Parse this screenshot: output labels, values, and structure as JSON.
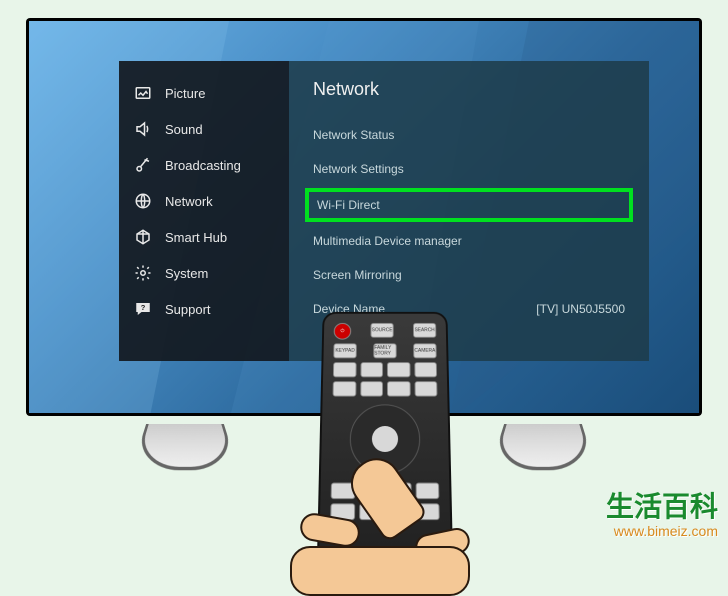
{
  "sidebar": {
    "items": [
      {
        "label": "Picture",
        "icon": "picture-icon"
      },
      {
        "label": "Sound",
        "icon": "sound-icon"
      },
      {
        "label": "Broadcasting",
        "icon": "broadcasting-icon"
      },
      {
        "label": "Network",
        "icon": "network-icon"
      },
      {
        "label": "Smart Hub",
        "icon": "smarthub-icon"
      },
      {
        "label": "System",
        "icon": "system-icon"
      },
      {
        "label": "Support",
        "icon": "support-icon"
      }
    ]
  },
  "content": {
    "title": "Network",
    "items": [
      {
        "label": "Network Status",
        "value": ""
      },
      {
        "label": "Network Settings",
        "value": ""
      },
      {
        "label": "Wi-Fi Direct",
        "value": "",
        "highlighted": true
      },
      {
        "label": "Multimedia Device manager",
        "value": ""
      },
      {
        "label": "Screen Mirroring",
        "value": ""
      },
      {
        "label": "Device Name",
        "value": "[TV] UN50J5500"
      }
    ]
  },
  "remote": {
    "buttons_row1": [
      "SOURCE",
      "POWER",
      "SEARCH"
    ],
    "buttons_row2": [
      "KEYPAD",
      "FAMILY STORY",
      "CAMERA"
    ]
  },
  "watermark": {
    "cn": "生活百科",
    "url": "www.bimeiz.com"
  }
}
